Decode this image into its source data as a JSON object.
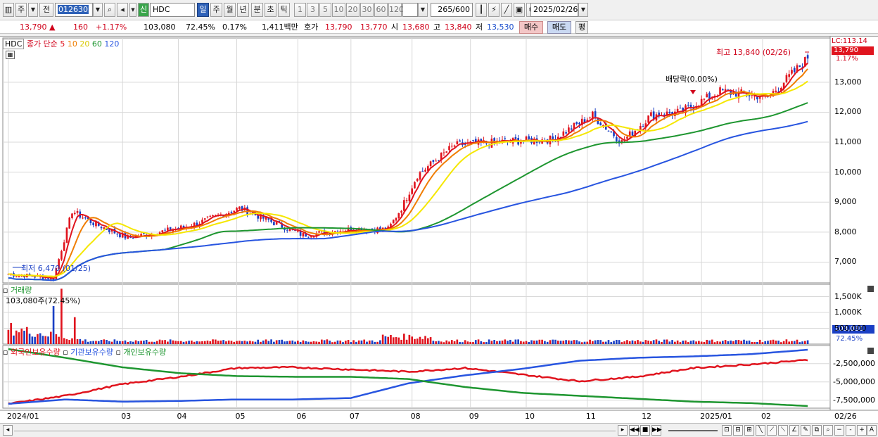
{
  "toolbar": {
    "period_type": "주",
    "prev_label": "전",
    "code": "012630",
    "name_badge": "신",
    "stock_name": "HDC",
    "period_buttons": [
      "일",
      "주",
      "월",
      "년",
      "분",
      "초",
      "틱"
    ],
    "selected_period": "일",
    "minute_buttons": [
      "1",
      "3",
      "5",
      "10",
      "20",
      "30",
      "60",
      "120"
    ],
    "count": "265",
    "count_total": "/600",
    "date": "2025/02/26"
  },
  "info": {
    "price": "13,790",
    "change": "160",
    "change_pct": "+1.17%",
    "volume": "103,080",
    "volume_ratio": "72.45%",
    "turnover_ratio": "0.17%",
    "amount": "1,411백만",
    "quote_label": "호가",
    "ask": "13,790",
    "bid": "13,770",
    "open_label": "시",
    "open": "13,680",
    "high_label": "고",
    "high": "13,840",
    "low_label": "저",
    "low": "13,530",
    "buy_label": "매수",
    "sell_label": "매도",
    "eval_label": "평"
  },
  "price_panel": {
    "name": "HDC",
    "ma_title": "종가 단순",
    "ma_periods": [
      "5",
      "10",
      "20",
      "60",
      "120"
    ],
    "ma_colors": [
      "#e0141e",
      "#f07d00",
      "#f5e700",
      "#1e9630",
      "#2855e0"
    ],
    "high_annotation": "최고 13,840 (02/26)",
    "low_annotation": "최저 6,470 (01/25)",
    "dividend_annotation": "배당락(0.00%)",
    "lc_label": "LC:113.14",
    "current_price_tag": "13,790",
    "current_pct_tag": "1.17%",
    "y_ticks": [
      "13,000",
      "12,000",
      "11,000",
      "10,000",
      "9,000",
      "8,000",
      "7,000"
    ]
  },
  "volume_panel": {
    "title": "거래량",
    "value_text": "103,080주(72.45%)",
    "y_ticks": [
      "1,500K",
      "1,000K",
      "500,000"
    ],
    "current_tag": "103,080",
    "current_pct_tag": "72.45%"
  },
  "holding_panel": {
    "series_titles": [
      "외국인보유수량",
      "기관보유수량",
      "개인보유수량"
    ],
    "series_colors": [
      "#e0141e",
      "#2855e0",
      "#1e9630"
    ],
    "y_ticks": [
      "-2,500,000",
      "-5,000,000",
      "-7,500,000"
    ]
  },
  "x_axis": {
    "labels": [
      "2024/01",
      "03",
      "04",
      "05",
      "06",
      "07",
      "08",
      "09",
      "10",
      "11",
      "12",
      "2025/01",
      "02"
    ],
    "right_label": "02/26"
  },
  "colors": {
    "up": "#e0141e",
    "down": "#1a3fc4",
    "grid": "#d8d8d8",
    "price_tag_bg": "#e0141e",
    "volume_tag_bg": "#1a3fc4"
  },
  "chart_data": {
    "type": "candlestick",
    "title": "HDC",
    "period": "daily",
    "range": [
      "2024/01",
      "2025/02/26"
    ],
    "price_ylim": [
      6400,
      14100
    ],
    "price_anchors": [
      {
        "x": "2024/01/02",
        "close": 6600
      },
      {
        "x": "2024/01/25",
        "close": 6470
      },
      {
        "x": "2024/02/05",
        "close": 8700
      },
      {
        "x": "2024/02/15",
        "close": 8300
      },
      {
        "x": "2024/03/05",
        "close": 7800
      },
      {
        "x": "2024/04/05",
        "close": 8200
      },
      {
        "x": "2024/05/02",
        "close": 8800
      },
      {
        "x": "2024/06/05",
        "close": 7900
      },
      {
        "x": "2024/07/01",
        "close": 8100
      },
      {
        "x": "2024/07/20",
        "close": 8100
      },
      {
        "x": "2024/07/28",
        "close": 8800
      },
      {
        "x": "2024/08/05",
        "close": 9900
      },
      {
        "x": "2024/08/25",
        "close": 10900
      },
      {
        "x": "2024/09/15",
        "close": 11000
      },
      {
        "x": "2024/10/15",
        "close": 11100
      },
      {
        "x": "2024/11/05",
        "close": 11900
      },
      {
        "x": "2024/11/20",
        "close": 11000
      },
      {
        "x": "2024/12/05",
        "close": 11900
      },
      {
        "x": "2024/12/20",
        "close": 12000
      },
      {
        "x": "2025/01/10",
        "close": 12700
      },
      {
        "x": "2025/02/05",
        "close": 12500
      },
      {
        "x": "2025/02/26",
        "close": 13790
      }
    ],
    "high": {
      "value": 13840,
      "date": "02/26"
    },
    "low": {
      "value": 6470,
      "date": "01/25"
    },
    "volume_ylim": [
      0,
      1800000
    ],
    "holding_ylim": [
      -8300000,
      -500000
    ],
    "holding_series": [
      {
        "name": "외국인보유수량",
        "values": [
          -8000000,
          -6900000,
          -5300000,
          -4300000,
          -3100000,
          -3000000,
          -3300000,
          -3600000,
          -3100000,
          -4000000,
          -4900000,
          -4300000,
          -3100000,
          -2600000,
          -2000000
        ]
      },
      {
        "name": "기관보유수량",
        "values": [
          -8000000,
          -7400000,
          -7700000,
          -7600000,
          -7400000,
          -7400000,
          -7200000,
          -5200000,
          -4100000,
          -3200000,
          -2100000,
          -1700000,
          -1500000,
          -1200000,
          -600000
        ]
      },
      {
        "name": "개인보유수량",
        "values": [
          -500000,
          -1700000,
          -3000000,
          -3800000,
          -4200000,
          -4300000,
          -4300000,
          -4600000,
          -5700000,
          -6500000,
          -6900000,
          -7300000,
          -7700000,
          -7900000,
          -8300000
        ]
      }
    ]
  }
}
